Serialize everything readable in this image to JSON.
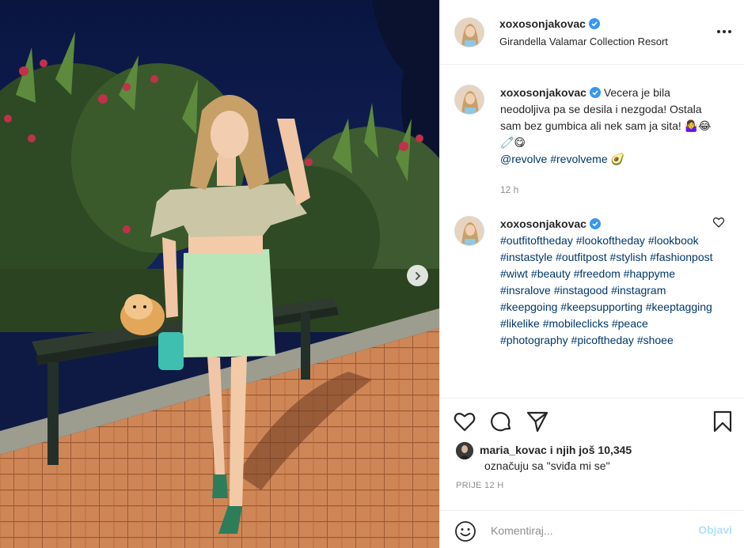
{
  "post": {
    "username": "xoxosonjakovac",
    "location": "Girandella Valamar Collection Resort",
    "caption": {
      "text_before_mention": "Vecera je bila neodoljiva pa se desila i nezgoda! Ostala sam bez gumbica ali nek sam ja sita! 🤷‍♀️😂🧷😋",
      "mention": "@revolve",
      "tag": "#revolveme",
      "trailing_emoji": "🥑",
      "time": "12 h"
    },
    "hashtag_comment": {
      "username": "xoxosonjakovac",
      "tags": [
        "#outfitoftheday",
        "#lookoftheday",
        "#lookbook",
        "#instastyle",
        "#outfitpost",
        "#stylish",
        "#fashionpost",
        "#wiwt",
        "#beauty",
        "#freedom",
        "#happyme",
        "#insralove",
        "#instagood",
        "#instagram",
        "#keepgoing",
        "#keepsupporting",
        "#keeptagging",
        "#likelike",
        "#mobileclicks",
        "#peace",
        "#photography",
        "#picoftheday",
        "#shoee"
      ]
    },
    "likes": {
      "first_user": "maria_kovac",
      "rest_text": " i njih još 10,345",
      "line2": "označuju sa \"sviđa mi se\""
    },
    "posted_ago": "PRIJE 12 H",
    "comment_box": {
      "placeholder": "Komentiraj...",
      "post_label": "Objavi"
    }
  },
  "icons": {
    "more": "more-options-icon",
    "verified": "verified-badge-icon",
    "heart": "heart-icon",
    "comment": "comment-icon",
    "share": "share-icon",
    "save": "bookmark-icon",
    "emoji": "emoji-icon",
    "next": "chevron-right-icon"
  },
  "colors": {
    "link": "#00376b",
    "verified": "#3897f0",
    "muted": "#8e8e8e",
    "post_disabled": "#b2dffc"
  }
}
